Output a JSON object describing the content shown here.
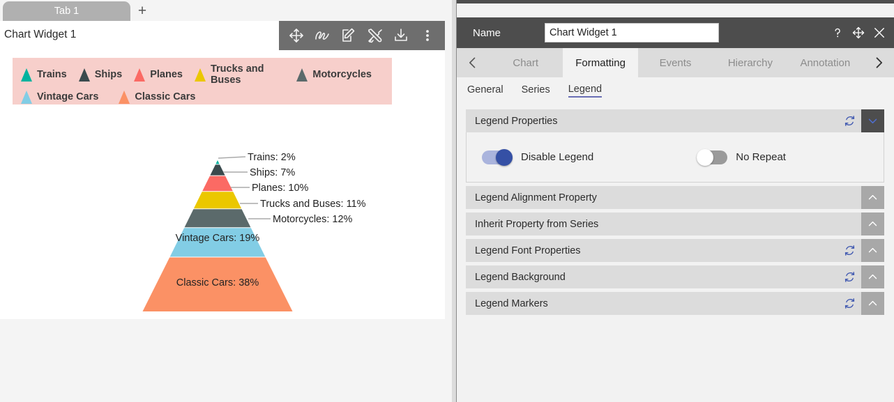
{
  "tabstrip": {
    "tabs": [
      {
        "label": "Tab 1"
      }
    ],
    "add_label": "+"
  },
  "widget": {
    "title": "Chart Widget 1",
    "toolbar": [
      {
        "name": "move-icon",
        "tooltip": "Move"
      },
      {
        "name": "scribble-icon",
        "tooltip": "Scribble"
      },
      {
        "name": "edit-icon",
        "tooltip": "Edit"
      },
      {
        "name": "tools-icon",
        "tooltip": "Tools"
      },
      {
        "name": "download-icon",
        "tooltip": "Download"
      },
      {
        "name": "more-vertical-icon",
        "tooltip": "More"
      }
    ]
  },
  "chart_data": {
    "type": "pie",
    "subtype": "pyramid",
    "title": "",
    "legend_position": "top",
    "legend_background": "#f7cfcb",
    "categories": [
      "Trains",
      "Ships",
      "Planes",
      "Trucks and Buses",
      "Motorcycles",
      "Vintage Cars",
      "Classic Cars"
    ],
    "values": [
      2,
      7,
      10,
      11,
      12,
      19,
      38
    ],
    "value_unit": "%",
    "colors": [
      "#00b39f",
      "#3a4a4d",
      "#fb6a64",
      "#ebc700",
      "#5b6a6b",
      "#82cde5",
      "#fb9165"
    ],
    "point_labels": [
      "Trains: 2%",
      "Ships: 7%",
      "Planes: 10%",
      "Trucks and Buses: 11%",
      "Motorcycles: 12%",
      "Vintage Cars: 19%",
      "Classic Cars: 38%"
    ],
    "legend_entries": [
      {
        "label": "Trains",
        "color": "#00b39f"
      },
      {
        "label": "Ships",
        "color": "#3a4a4d"
      },
      {
        "label": "Planes",
        "color": "#fb6a64"
      },
      {
        "label": "Trucks and Buses",
        "color": "#ebc700"
      },
      {
        "label": "Motorcycles",
        "color": "#5b6a6b"
      },
      {
        "label": "Vintage Cars",
        "color": "#82cde5"
      },
      {
        "label": "Classic Cars",
        "color": "#fb9165"
      }
    ]
  },
  "panel": {
    "name_label": "Name",
    "name_value": "Chart Widget 1",
    "name_placeholder": "Name",
    "actions": [
      {
        "name": "help-icon",
        "glyph": "?"
      },
      {
        "name": "move-icon",
        "glyph": ""
      },
      {
        "name": "close-icon",
        "glyph": "✕"
      }
    ],
    "tabs": [
      {
        "label": "Chart",
        "active": false
      },
      {
        "label": "Formatting",
        "active": true
      },
      {
        "label": "Events",
        "active": false
      },
      {
        "label": "Hierarchy",
        "active": false
      },
      {
        "label": "Annotation",
        "active": false
      }
    ],
    "subtabs": [
      {
        "label": "General",
        "active": false
      },
      {
        "label": "Series",
        "active": false
      },
      {
        "label": "Legend",
        "active": true
      }
    ],
    "sections": [
      {
        "title": "Legend Properties",
        "expanded": true,
        "has_refresh": true,
        "toggles": [
          {
            "label": "Disable Legend",
            "state": "on"
          },
          {
            "label": "No Repeat",
            "state": "off"
          }
        ]
      },
      {
        "title": "Legend Alignment Property",
        "expanded": false,
        "has_refresh": false
      },
      {
        "title": "Inherit Property from Series",
        "expanded": false,
        "has_refresh": false
      },
      {
        "title": "Legend Font Properties",
        "expanded": false,
        "has_refresh": true
      },
      {
        "title": "Legend Background",
        "expanded": false,
        "has_refresh": true
      },
      {
        "title": "Legend Markers",
        "expanded": false,
        "has_refresh": true
      }
    ]
  }
}
